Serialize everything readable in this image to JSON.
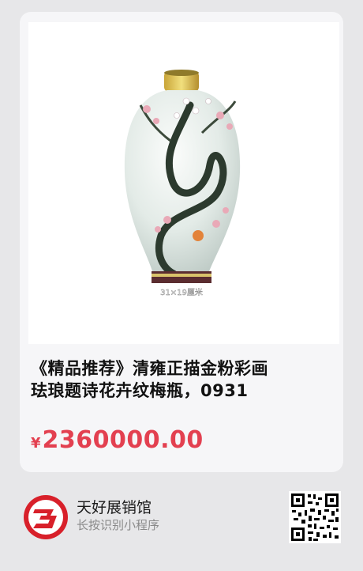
{
  "product": {
    "title_line1": "《精品推荐》清雍正描金粉彩画",
    "title_line2": "珐琅题诗花卉纹梅瓶，0931",
    "currency_symbol": "¥",
    "price": "2360000.00",
    "image_caption": "31×19厘米",
    "image_icon": "vase-photo"
  },
  "footer": {
    "shop_name": "天好展销馆",
    "hint": "长按识别小程序",
    "logo_icon": "shop-logo-icon",
    "qr_icon": "qr-code-icon"
  },
  "colors": {
    "price": "#e34050",
    "logo_red": "#d8202a"
  }
}
